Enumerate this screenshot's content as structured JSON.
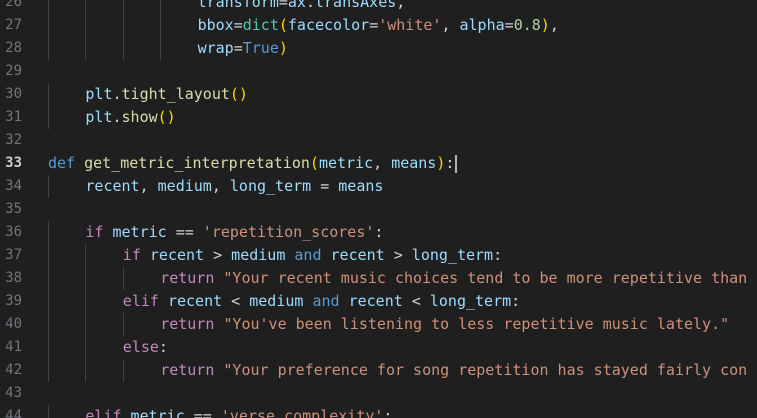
{
  "editor": {
    "language": "python",
    "active_line": "33",
    "colors": {
      "background": "#1f1f1f",
      "keyword": "#569cd6",
      "control": "#c586c0",
      "function": "#dcdcaa",
      "variable": "#9cdcfe",
      "string": "#ce9178",
      "number": "#b5cea8",
      "line_number": "#6e7681"
    }
  },
  "lines": [
    {
      "num": "26",
      "indent": 4,
      "tokens": [
        {
          "t": "transform",
          "c": "var"
        },
        {
          "t": "=",
          "c": "op"
        },
        {
          "t": "ax",
          "c": "var"
        },
        {
          "t": ".",
          "c": "op"
        },
        {
          "t": "transAxes",
          "c": "var"
        },
        {
          "t": ",",
          "c": "op"
        }
      ]
    },
    {
      "num": "27",
      "indent": 4,
      "tokens": [
        {
          "t": "bbox",
          "c": "var"
        },
        {
          "t": "=",
          "c": "op"
        },
        {
          "t": "dict",
          "c": "bi"
        },
        {
          "t": "(",
          "c": "par"
        },
        {
          "t": "facecolor",
          "c": "var"
        },
        {
          "t": "=",
          "c": "op"
        },
        {
          "t": "'white'",
          "c": "str"
        },
        {
          "t": ", ",
          "c": "op"
        },
        {
          "t": "alpha",
          "c": "var"
        },
        {
          "t": "=",
          "c": "op"
        },
        {
          "t": "0.8",
          "c": "num"
        },
        {
          "t": ")",
          "c": "par"
        },
        {
          "t": ",",
          "c": "op"
        }
      ]
    },
    {
      "num": "28",
      "indent": 4,
      "tokens": [
        {
          "t": "wrap",
          "c": "var"
        },
        {
          "t": "=",
          "c": "op"
        },
        {
          "t": "True",
          "c": "kw"
        },
        {
          "t": ")",
          "c": "par"
        }
      ]
    },
    {
      "num": "29",
      "indent": 0,
      "tokens": []
    },
    {
      "num": "30",
      "indent": 1,
      "tokens": [
        {
          "t": "plt",
          "c": "var"
        },
        {
          "t": ".",
          "c": "op"
        },
        {
          "t": "tight_layout",
          "c": "fn"
        },
        {
          "t": "()",
          "c": "par"
        }
      ]
    },
    {
      "num": "31",
      "indent": 1,
      "tokens": [
        {
          "t": "plt",
          "c": "var"
        },
        {
          "t": ".",
          "c": "op"
        },
        {
          "t": "show",
          "c": "fn"
        },
        {
          "t": "()",
          "c": "par"
        }
      ]
    },
    {
      "num": "32",
      "indent": 0,
      "tokens": []
    },
    {
      "num": "33",
      "indent": 0,
      "cursor": true,
      "tokens": [
        {
          "t": "def",
          "c": "kw"
        },
        {
          "t": " ",
          "c": "plain"
        },
        {
          "t": "get_metric_interpretation",
          "c": "fn"
        },
        {
          "t": "(",
          "c": "par"
        },
        {
          "t": "metric",
          "c": "var"
        },
        {
          "t": ", ",
          "c": "op"
        },
        {
          "t": "means",
          "c": "var"
        },
        {
          "t": ")",
          "c": "par"
        },
        {
          "t": ":",
          "c": "op"
        }
      ]
    },
    {
      "num": "34",
      "indent": 1,
      "tokens": [
        {
          "t": "recent",
          "c": "var"
        },
        {
          "t": ", ",
          "c": "op"
        },
        {
          "t": "medium",
          "c": "var"
        },
        {
          "t": ", ",
          "c": "op"
        },
        {
          "t": "long_term",
          "c": "var"
        },
        {
          "t": " = ",
          "c": "op"
        },
        {
          "t": "means",
          "c": "var"
        }
      ]
    },
    {
      "num": "35",
      "indent": 0,
      "tokens": []
    },
    {
      "num": "36",
      "indent": 1,
      "tokens": [
        {
          "t": "if",
          "c": "ctl"
        },
        {
          "t": " ",
          "c": "plain"
        },
        {
          "t": "metric",
          "c": "var"
        },
        {
          "t": " == ",
          "c": "op"
        },
        {
          "t": "'repetition_scores'",
          "c": "str"
        },
        {
          "t": ":",
          "c": "op"
        }
      ]
    },
    {
      "num": "37",
      "indent": 2,
      "tokens": [
        {
          "t": "if",
          "c": "ctl"
        },
        {
          "t": " ",
          "c": "plain"
        },
        {
          "t": "recent",
          "c": "var"
        },
        {
          "t": " > ",
          "c": "op"
        },
        {
          "t": "medium",
          "c": "var"
        },
        {
          "t": " ",
          "c": "plain"
        },
        {
          "t": "and",
          "c": "kw"
        },
        {
          "t": " ",
          "c": "plain"
        },
        {
          "t": "recent",
          "c": "var"
        },
        {
          "t": " > ",
          "c": "op"
        },
        {
          "t": "long_term",
          "c": "var"
        },
        {
          "t": ":",
          "c": "op"
        }
      ]
    },
    {
      "num": "38",
      "indent": 3,
      "tokens": [
        {
          "t": "return",
          "c": "ctl"
        },
        {
          "t": " ",
          "c": "plain"
        },
        {
          "t": "\"Your recent music choices tend to be more repetitive than",
          "c": "str"
        }
      ]
    },
    {
      "num": "39",
      "indent": 2,
      "tokens": [
        {
          "t": "elif",
          "c": "ctl"
        },
        {
          "t": " ",
          "c": "plain"
        },
        {
          "t": "recent",
          "c": "var"
        },
        {
          "t": " < ",
          "c": "op"
        },
        {
          "t": "medium",
          "c": "var"
        },
        {
          "t": " ",
          "c": "plain"
        },
        {
          "t": "and",
          "c": "kw"
        },
        {
          "t": " ",
          "c": "plain"
        },
        {
          "t": "recent",
          "c": "var"
        },
        {
          "t": " < ",
          "c": "op"
        },
        {
          "t": "long_term",
          "c": "var"
        },
        {
          "t": ":",
          "c": "op"
        }
      ]
    },
    {
      "num": "40",
      "indent": 3,
      "tokens": [
        {
          "t": "return",
          "c": "ctl"
        },
        {
          "t": " ",
          "c": "plain"
        },
        {
          "t": "\"You've been listening to less repetitive music lately.\"",
          "c": "str"
        }
      ]
    },
    {
      "num": "41",
      "indent": 2,
      "tokens": [
        {
          "t": "else",
          "c": "ctl"
        },
        {
          "t": ":",
          "c": "op"
        }
      ]
    },
    {
      "num": "42",
      "indent": 3,
      "tokens": [
        {
          "t": "return",
          "c": "ctl"
        },
        {
          "t": " ",
          "c": "plain"
        },
        {
          "t": "\"Your preference for song repetition has stayed fairly con",
          "c": "str"
        }
      ]
    },
    {
      "num": "43",
      "indent": 0,
      "tokens": []
    },
    {
      "num": "44",
      "indent": 1,
      "tokens": [
        {
          "t": "elif",
          "c": "ctl"
        },
        {
          "t": " ",
          "c": "plain"
        },
        {
          "t": "metric",
          "c": "var"
        },
        {
          "t": " == ",
          "c": "op"
        },
        {
          "t": "'verse_complexity'",
          "c": "str"
        },
        {
          "t": ":",
          "c": "op"
        }
      ]
    }
  ]
}
